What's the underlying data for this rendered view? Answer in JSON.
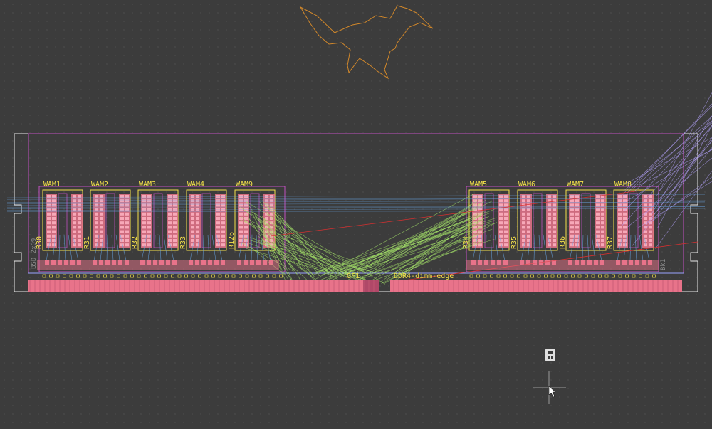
{
  "app": {
    "view": "PCB layout canvas"
  },
  "board": {
    "left_modules": [
      {
        "ref": "WAM1",
        "res": "R30"
      },
      {
        "ref": "WAM2",
        "res": "R31"
      },
      {
        "ref": "WAM3",
        "res": "R32"
      },
      {
        "ref": "WAM4",
        "res": "R33"
      },
      {
        "ref": "WAM9",
        "res": "R126"
      }
    ],
    "right_modules": [
      {
        "ref": "WAM5",
        "res": "R34"
      },
      {
        "ref": "WAM6",
        "res": "R35"
      },
      {
        "ref": "WAM7",
        "res": "R36"
      },
      {
        "ref": "WAM8",
        "res": "R37"
      }
    ],
    "gf_label": "GF1",
    "edge_label": "DDR4-dimm-edge",
    "side_text": "BSD 2x09",
    "right_side_text": "Bk1"
  },
  "colors": {
    "background": "#3c3c3c",
    "board_outline": "#e8e8e8",
    "pads": "#e8738a",
    "silkscreen": "#f4e14a",
    "courtyard": "#c050c0",
    "ratsnest_green": "#a8e86a",
    "ratsnest_blue": "#6aa8e8",
    "ratsnest_red": "#d83030",
    "logo_outline": "#d2882a"
  },
  "icons": [
    "kicad-logo-icon",
    "crosshair-cursor-icon"
  ]
}
